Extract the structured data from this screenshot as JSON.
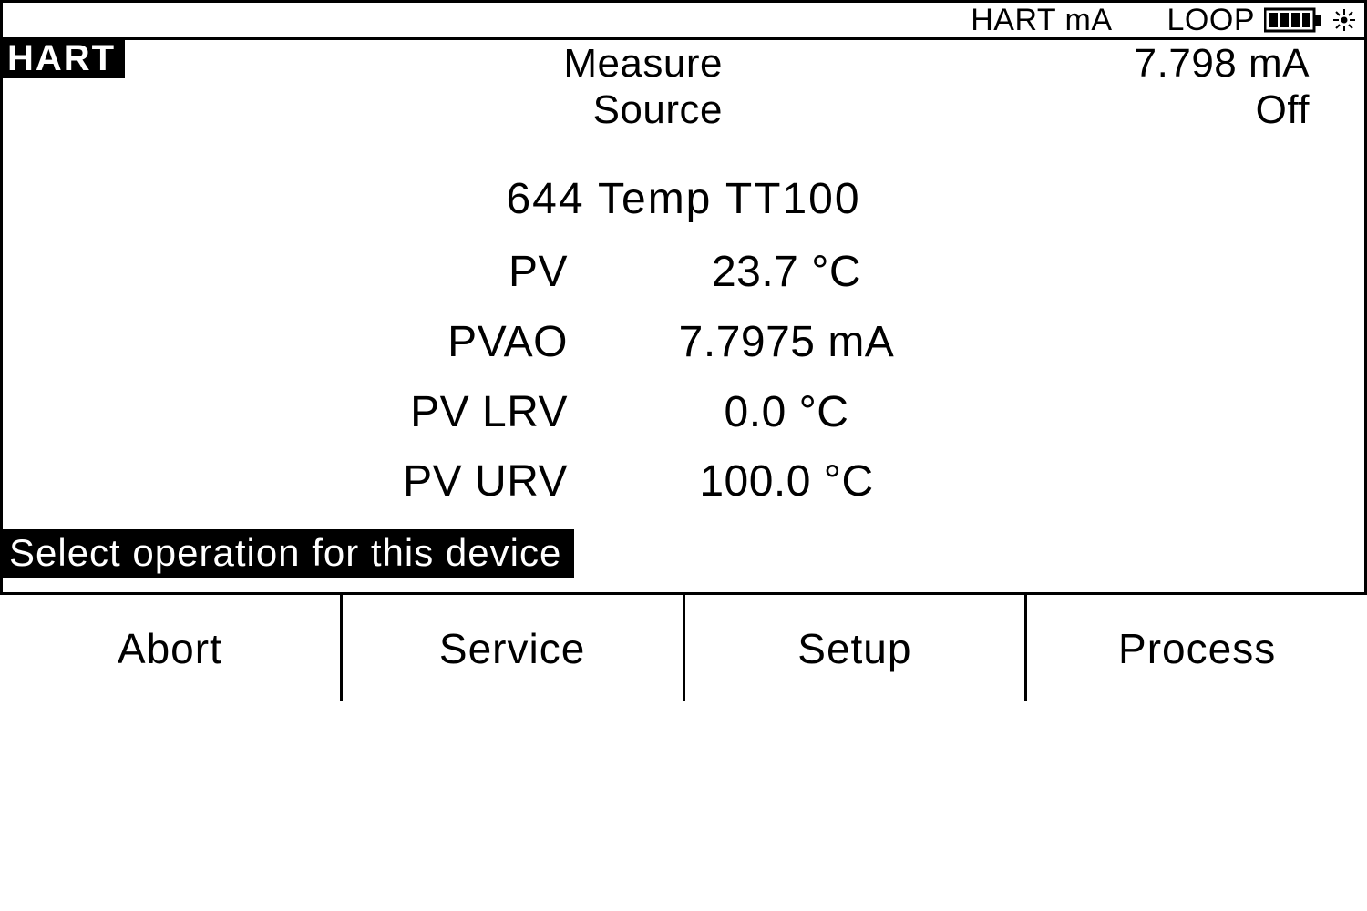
{
  "status": {
    "mode": "HART mA",
    "loop": "LOOP"
  },
  "tag": "HART",
  "readout": {
    "measure_label": "Measure",
    "measure_value": "7.798 mA",
    "source_label": "Source",
    "source_value": "Off"
  },
  "device": {
    "name": "644 Temp  TT100",
    "rows": [
      {
        "label": "PV",
        "value": "23.7 °C"
      },
      {
        "label": "PVAO",
        "value": "7.7975 mA"
      },
      {
        "label": "PV LRV",
        "value": "0.0 °C"
      },
      {
        "label": "PV URV",
        "value": "100.0 °C"
      }
    ]
  },
  "prompt": "Select operation for this device",
  "softkeys": [
    "Abort",
    "Service",
    "Setup",
    "Process"
  ]
}
